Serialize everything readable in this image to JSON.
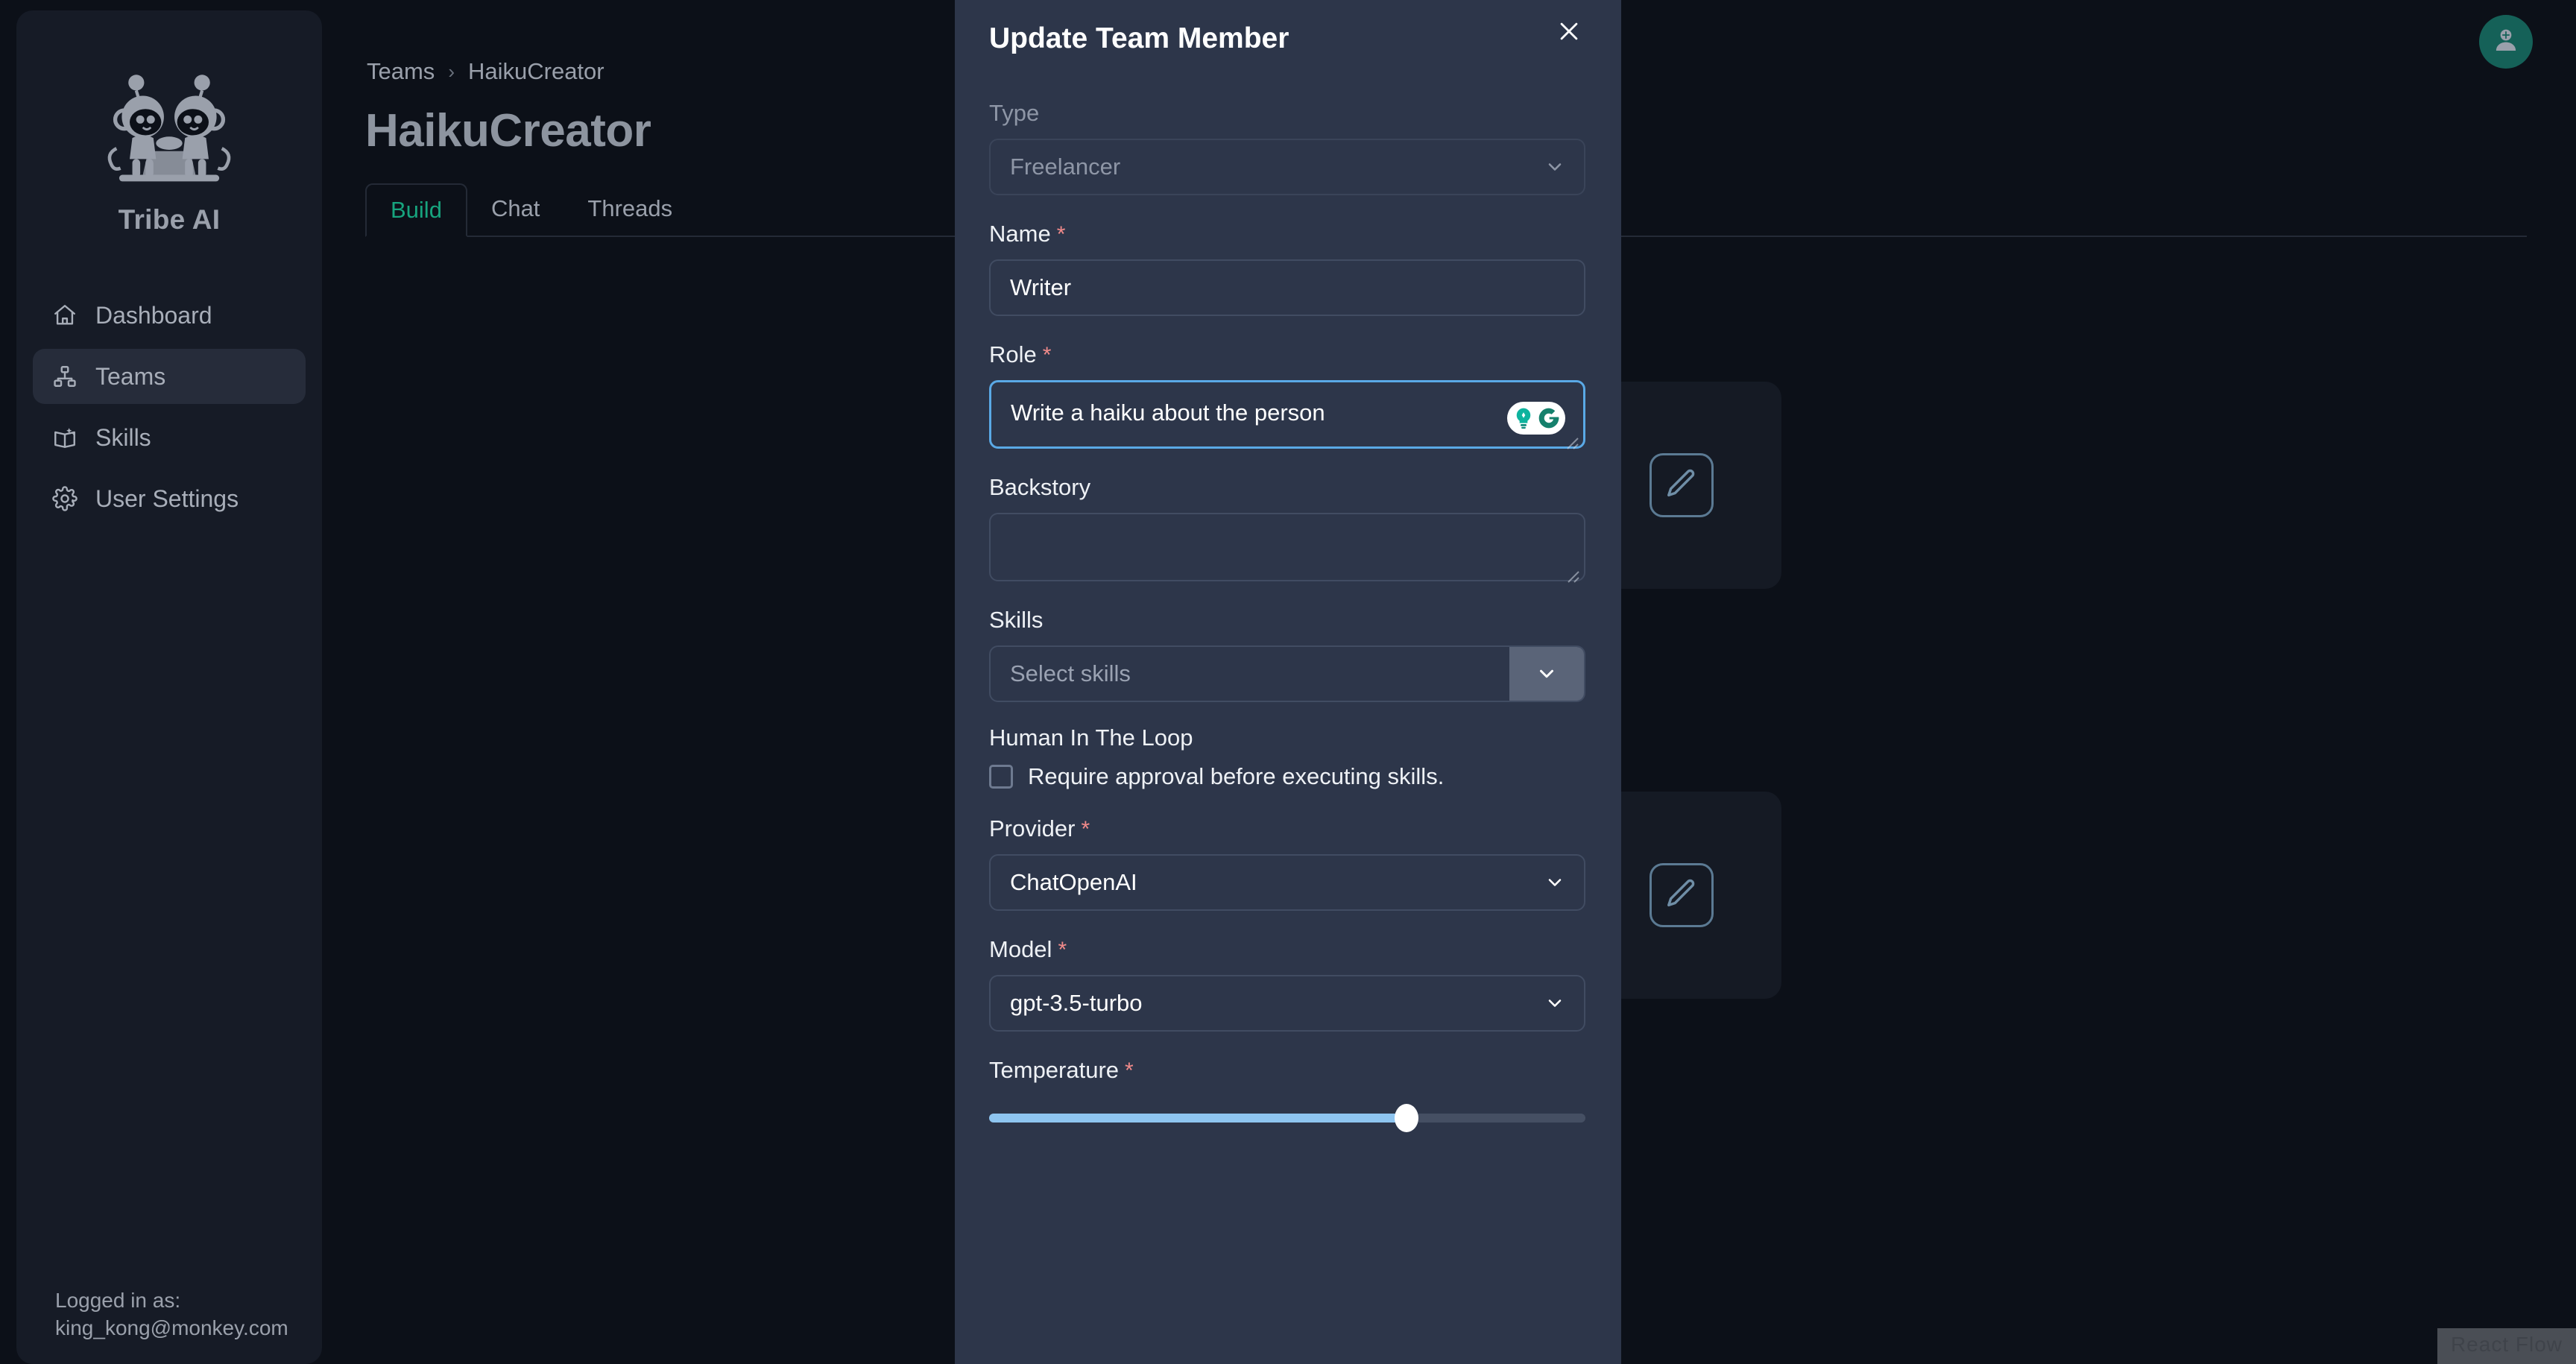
{
  "app": {
    "brand_name": "Tribe AI",
    "logo_icon": "two-monkeys-logo"
  },
  "sidebar": {
    "items": [
      {
        "label": "Dashboard",
        "icon": "home-icon",
        "active": false
      },
      {
        "label": "Teams",
        "icon": "hierarchy-icon",
        "active": true
      },
      {
        "label": "Skills",
        "icon": "book-sparkle-icon",
        "active": false
      },
      {
        "label": "User Settings",
        "icon": "gear-icon",
        "active": false
      }
    ],
    "footer": {
      "logged_in_label": "Logged in as:",
      "email": "king_kong@monkey.com"
    }
  },
  "header": {
    "breadcrumb": {
      "root": "Teams",
      "separator": "›",
      "current": "HaikuCreator"
    },
    "title": "HaikuCreator",
    "avatar_icon": "user-avatar-icon",
    "avatar_color": "#156158"
  },
  "tabs": [
    {
      "label": "Build",
      "active": true
    },
    {
      "label": "Chat",
      "active": false
    },
    {
      "label": "Threads",
      "active": false
    }
  ],
  "canvas": {
    "nodes": [
      {
        "edit_icon": "pencil-icon"
      },
      {
        "edit_icon": "pencil-icon"
      }
    ],
    "attribution": "React Flow"
  },
  "modal": {
    "title": "Update Team Member",
    "close_icon": "close-icon",
    "fields": {
      "type": {
        "label": "Type",
        "value": "Freelancer",
        "disabled": true,
        "chevron_icon": "chevron-down-icon"
      },
      "name": {
        "label": "Name",
        "required_marker": "*",
        "value": "Writer"
      },
      "role": {
        "label": "Role",
        "required_marker": "*",
        "value": "Write a haiku about the person",
        "focused": true,
        "grammarly_icon": "grammarly-badge-icon"
      },
      "backstory": {
        "label": "Backstory",
        "value": "",
        "placeholder": ""
      },
      "skills": {
        "label": "Skills",
        "placeholder": "Select skills",
        "value": "",
        "chevron_icon": "chevron-down-icon"
      },
      "human_in_the_loop": {
        "label": "Human In The Loop",
        "checkbox_label": "Require approval before executing skills.",
        "checked": false
      },
      "provider": {
        "label": "Provider",
        "required_marker": "*",
        "value": "ChatOpenAI",
        "chevron_icon": "chevron-down-icon"
      },
      "model": {
        "label": "Model",
        "required_marker": "*",
        "value": "gpt-3.5-turbo",
        "chevron_icon": "chevron-down-icon"
      },
      "temperature": {
        "label": "Temperature",
        "required_marker": "*",
        "percent": 70
      }
    }
  },
  "colors": {
    "accent_teal": "#17a47e",
    "focus_blue": "#5aa9e6",
    "required_red": "#f08a8a",
    "slider_fill": "#8ec5f0",
    "modal_bg": "#2d364a",
    "app_bg": "#0c1018"
  }
}
